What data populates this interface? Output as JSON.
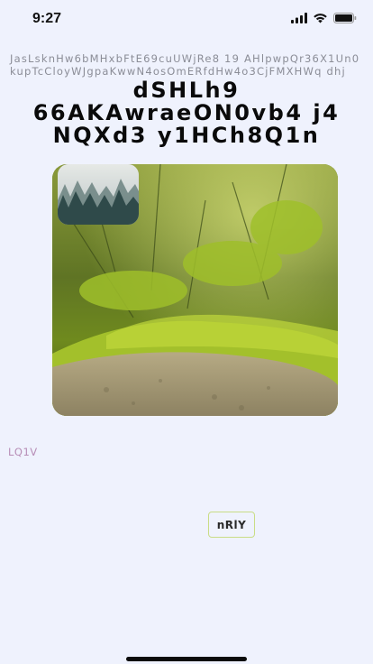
{
  "status_bar": {
    "time": "9:27",
    "icons": [
      "signal-icon",
      "wifi-icon",
      "battery-icon"
    ]
  },
  "meta_text": "JasLsknHw6bMHxbFtE69cuUWjRe8 19 AHlpwpQr36X1Un0kupTcCloyWJgpaKwwN4osOmERfdHw4o3CjFMXHWq dhj",
  "title": "dSHLh9 66AKAwraeON0vb4 j4 NQXd3 y1HCh8Q1n",
  "images": {
    "main": "moss-forest-floor-photo",
    "thumbnail": "misty-forest-photo"
  },
  "small_link": "LQ1V",
  "pill_button": "nRlY",
  "colors": {
    "background": "#eff2fd",
    "link": "#b78db6",
    "button_border": "#c9dd86"
  }
}
